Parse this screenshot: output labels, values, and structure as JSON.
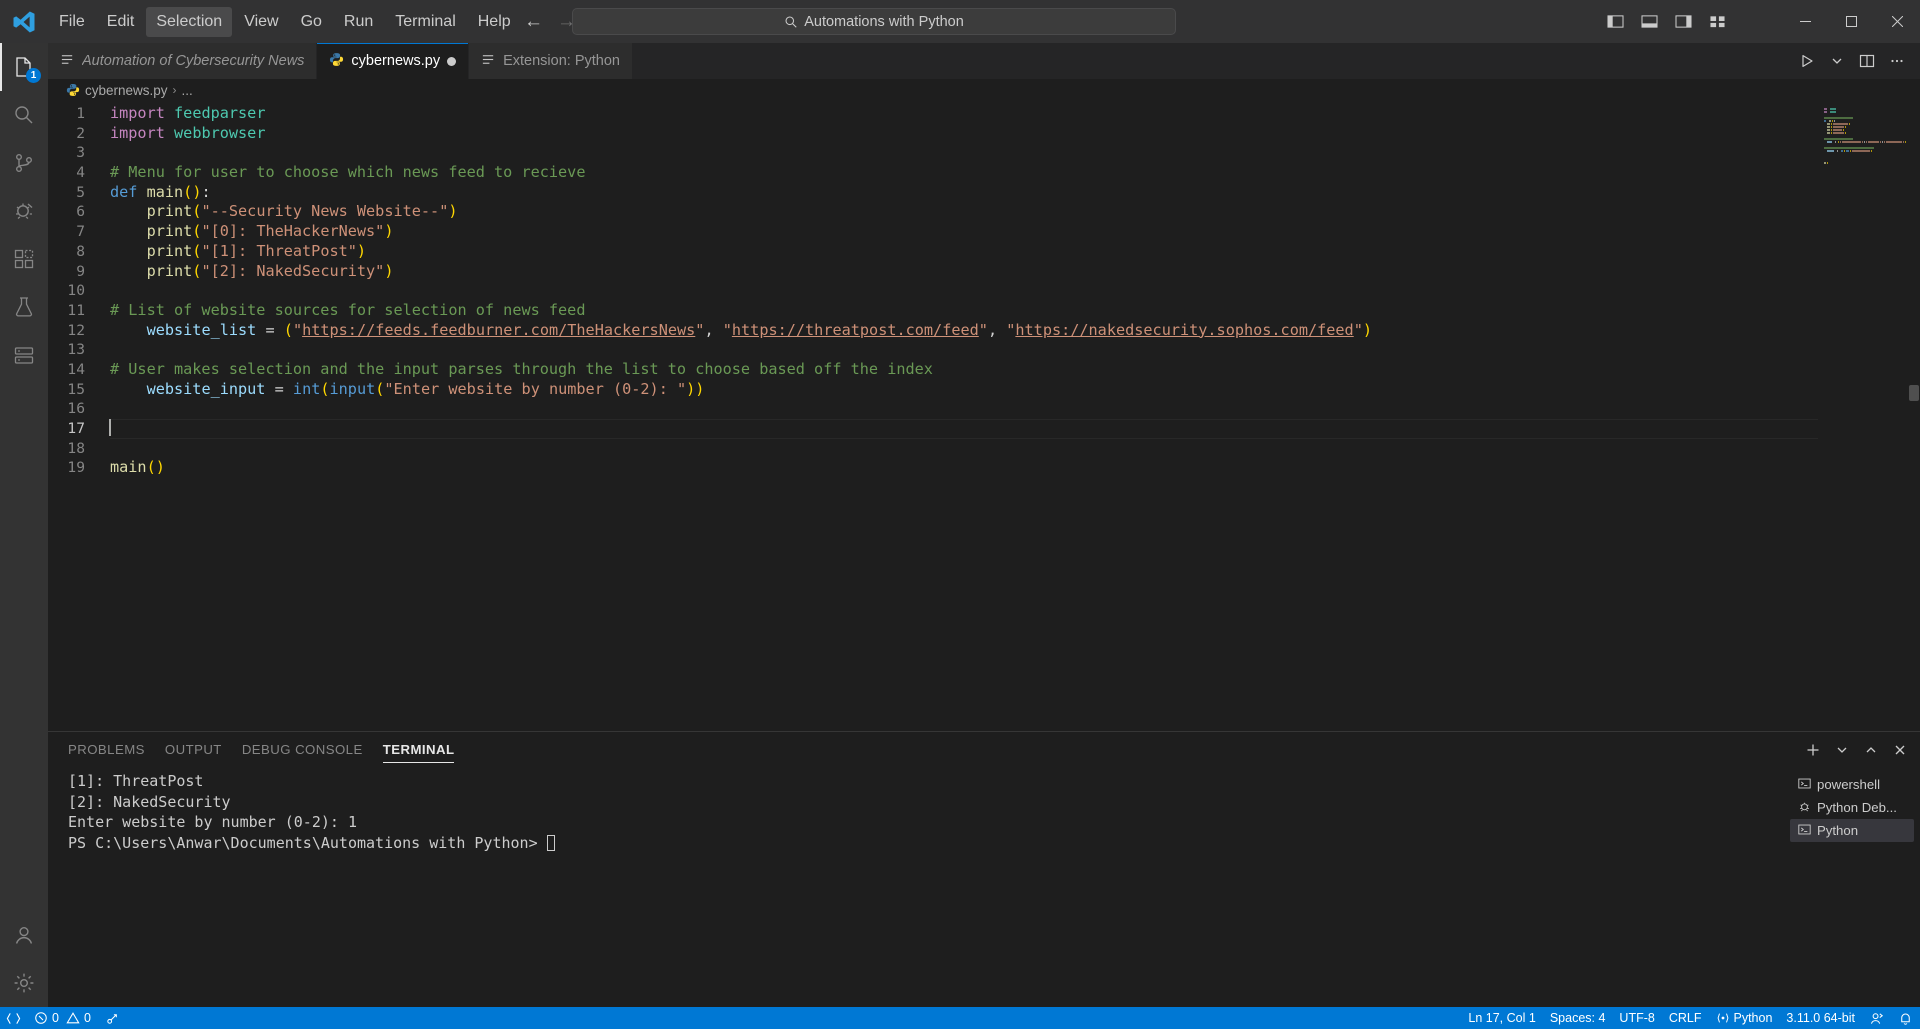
{
  "titlebar": {
    "logo_icon": "vscode-logo-icon",
    "menu": [
      {
        "label": "File",
        "active": false
      },
      {
        "label": "Edit",
        "active": false
      },
      {
        "label": "Selection",
        "active": true
      },
      {
        "label": "View",
        "active": false
      },
      {
        "label": "Go",
        "active": false
      },
      {
        "label": "Run",
        "active": false
      },
      {
        "label": "Terminal",
        "active": false
      },
      {
        "label": "Help",
        "active": false
      }
    ],
    "nav_back_icon": "arrow-left-icon",
    "nav_forward_icon": "arrow-right-icon",
    "search": {
      "value": "Automations with Python",
      "placeholder": "Search",
      "icon": "search-icon"
    },
    "layout_icons": [
      "toggle-primary-sidebar-icon",
      "toggle-panel-icon",
      "toggle-secondary-sidebar-icon",
      "customize-layout-icon"
    ],
    "window_controls": [
      "minimize-icon",
      "maximize-icon",
      "close-icon"
    ]
  },
  "activitybar": {
    "items": [
      {
        "name": "explorer",
        "icon": "files-icon",
        "active": true,
        "badge": "1"
      },
      {
        "name": "search",
        "icon": "search-icon",
        "active": false,
        "badge": ""
      },
      {
        "name": "source-control",
        "icon": "source-control-icon",
        "active": false,
        "badge": ""
      },
      {
        "name": "run-and-debug",
        "icon": "debug-alt-icon",
        "active": false,
        "badge": ""
      },
      {
        "name": "extensions",
        "icon": "extensions-icon",
        "active": false,
        "badge": ""
      },
      {
        "name": "testing",
        "icon": "beaker-icon",
        "active": false,
        "badge": ""
      },
      {
        "name": "remote-explorer",
        "icon": "remote-explorer-icon",
        "active": false,
        "badge": ""
      }
    ],
    "bottom_items": [
      {
        "name": "accounts",
        "icon": "account-icon"
      },
      {
        "name": "manage",
        "icon": "gear-icon"
      }
    ]
  },
  "tabs": [
    {
      "label": "Automation of Cybersecurity News",
      "icon": "markdown-icon",
      "active": false,
      "preview": true,
      "dirty": false
    },
    {
      "label": "cybernews.py",
      "icon": "python-icon",
      "active": true,
      "preview": false,
      "dirty": true
    },
    {
      "label": "Extension: Python",
      "icon": "markdown-icon",
      "active": false,
      "preview": false,
      "dirty": false
    }
  ],
  "tab_actions": [
    {
      "name": "run-python-file",
      "icon": "play-icon"
    },
    {
      "name": "run-options-chevron",
      "icon": "chevron-down-icon"
    },
    {
      "name": "split-editor-right",
      "icon": "split-editor-icon"
    },
    {
      "name": "more-actions",
      "icon": "ellipsis-icon"
    }
  ],
  "breadcrumb": {
    "file_icon": "python-icon",
    "file": "cybernews.py",
    "separator": "›",
    "more": "..."
  },
  "editor": {
    "filename": "cybernews.py",
    "language": "Python",
    "lines": [
      {
        "n": "1",
        "cur": false,
        "tokens": [
          {
            "t": "import",
            "c": "k-import"
          },
          {
            "t": " ",
            "c": "plain"
          },
          {
            "t": "feedparser",
            "c": "mod"
          }
        ]
      },
      {
        "n": "2",
        "cur": false,
        "tokens": [
          {
            "t": "import",
            "c": "k-import"
          },
          {
            "t": " ",
            "c": "plain"
          },
          {
            "t": "webbrowser",
            "c": "mod"
          }
        ]
      },
      {
        "n": "3",
        "cur": false,
        "tokens": []
      },
      {
        "n": "4",
        "cur": false,
        "tokens": [
          {
            "t": "# Menu for user to choose which news feed to recieve",
            "c": "cmt"
          }
        ]
      },
      {
        "n": "5",
        "cur": false,
        "tokens": [
          {
            "t": "def",
            "c": "k-def"
          },
          {
            "t": " ",
            "c": "plain"
          },
          {
            "t": "main",
            "c": "fn"
          },
          {
            "t": "()",
            "c": "paren"
          },
          {
            "t": ":",
            "c": "plain"
          }
        ]
      },
      {
        "n": "6",
        "cur": false,
        "tokens": [
          {
            "t": "    ",
            "c": "plain"
          },
          {
            "t": "print",
            "c": "fn"
          },
          {
            "t": "(",
            "c": "paren"
          },
          {
            "t": "\"--Security News Website--\"",
            "c": "str"
          },
          {
            "t": ")",
            "c": "paren"
          }
        ]
      },
      {
        "n": "7",
        "cur": false,
        "tokens": [
          {
            "t": "    ",
            "c": "plain"
          },
          {
            "t": "print",
            "c": "fn"
          },
          {
            "t": "(",
            "c": "paren"
          },
          {
            "t": "\"[0]: TheHackerNews\"",
            "c": "str"
          },
          {
            "t": ")",
            "c": "paren"
          }
        ]
      },
      {
        "n": "8",
        "cur": false,
        "tokens": [
          {
            "t": "    ",
            "c": "plain"
          },
          {
            "t": "print",
            "c": "fn"
          },
          {
            "t": "(",
            "c": "paren"
          },
          {
            "t": "\"[1]: ThreatPost\"",
            "c": "str"
          },
          {
            "t": ")",
            "c": "paren"
          }
        ]
      },
      {
        "n": "9",
        "cur": false,
        "tokens": [
          {
            "t": "    ",
            "c": "plain"
          },
          {
            "t": "print",
            "c": "fn"
          },
          {
            "t": "(",
            "c": "paren"
          },
          {
            "t": "\"[2]: NakedSecurity\"",
            "c": "str"
          },
          {
            "t": ")",
            "c": "paren"
          }
        ]
      },
      {
        "n": "10",
        "cur": false,
        "tokens": []
      },
      {
        "n": "11",
        "cur": false,
        "tokens": [
          {
            "t": "# List of website sources for selection of news feed",
            "c": "cmt"
          }
        ]
      },
      {
        "n": "12",
        "cur": false,
        "tokens": [
          {
            "t": "    ",
            "c": "plain"
          },
          {
            "t": "website_list",
            "c": "var"
          },
          {
            "t": " ",
            "c": "plain"
          },
          {
            "t": "=",
            "c": "op"
          },
          {
            "t": " ",
            "c": "plain"
          },
          {
            "t": "(",
            "c": "paren"
          },
          {
            "t": "\"",
            "c": "str"
          },
          {
            "t": "https://feeds.feedburner.com/TheHackersNews",
            "c": "link"
          },
          {
            "t": "\"",
            "c": "str"
          },
          {
            "t": ", ",
            "c": "plain"
          },
          {
            "t": "\"",
            "c": "str"
          },
          {
            "t": "https://threatpost.com/feed",
            "c": "link"
          },
          {
            "t": "\"",
            "c": "str"
          },
          {
            "t": ", ",
            "c": "plain"
          },
          {
            "t": "\"",
            "c": "str"
          },
          {
            "t": "https://nakedsecurity.sophos.com/feed",
            "c": "link"
          },
          {
            "t": "\"",
            "c": "str"
          },
          {
            "t": ")",
            "c": "paren"
          }
        ]
      },
      {
        "n": "13",
        "cur": false,
        "tokens": []
      },
      {
        "n": "14",
        "cur": false,
        "tokens": [
          {
            "t": "# User makes selection and the input parses through the list to choose based off the index",
            "c": "cmt"
          }
        ]
      },
      {
        "n": "15",
        "cur": false,
        "tokens": [
          {
            "t": "    ",
            "c": "plain"
          },
          {
            "t": "website_input",
            "c": "var"
          },
          {
            "t": " ",
            "c": "plain"
          },
          {
            "t": "=",
            "c": "op"
          },
          {
            "t": " ",
            "c": "plain"
          },
          {
            "t": "int",
            "c": "k-def"
          },
          {
            "t": "(",
            "c": "paren"
          },
          {
            "t": "input",
            "c": "k-def"
          },
          {
            "t": "(",
            "c": "paren"
          },
          {
            "t": "\"Enter website by number (0-2): \"",
            "c": "str"
          },
          {
            "t": "))",
            "c": "paren"
          }
        ]
      },
      {
        "n": "16",
        "cur": false,
        "tokens": []
      },
      {
        "n": "17",
        "cur": true,
        "tokens": []
      },
      {
        "n": "18",
        "cur": false,
        "tokens": []
      },
      {
        "n": "19",
        "cur": false,
        "tokens": [
          {
            "t": "main",
            "c": "fn"
          },
          {
            "t": "()",
            "c": "paren"
          }
        ]
      }
    ]
  },
  "panel": {
    "tabs": [
      {
        "label": "PROBLEMS",
        "active": false
      },
      {
        "label": "OUTPUT",
        "active": false
      },
      {
        "label": "DEBUG CONSOLE",
        "active": false
      },
      {
        "label": "TERMINAL",
        "active": true
      }
    ],
    "actions": [
      {
        "name": "new-terminal",
        "icon": "plus-icon"
      },
      {
        "name": "split-terminal-chevron",
        "icon": "chevron-down-icon"
      },
      {
        "name": "maximize-panel",
        "icon": "chevron-up-icon"
      },
      {
        "name": "close-panel",
        "icon": "close-icon"
      }
    ],
    "terminal_output": [
      "[1]: ThreatPost",
      "[2]: NakedSecurity",
      "Enter website by number (0-2): 1"
    ],
    "terminal_prompt": "PS C:\\Users\\Anwar\\Documents\\Automations with Python> ",
    "terminal_instances": [
      {
        "label": "powershell",
        "icon": "terminal-icon",
        "active": false
      },
      {
        "label": "Python Deb...",
        "icon": "debug-icon",
        "active": false
      },
      {
        "label": "Python",
        "icon": "terminal-icon",
        "active": true
      }
    ]
  },
  "statusbar": {
    "left": [
      {
        "name": "remote-indicator",
        "icon": "remote-icon",
        "label": ""
      },
      {
        "name": "problems",
        "icon": "error-warning-icon",
        "label": "0  0",
        "errors": "0",
        "warnings": "0"
      },
      {
        "name": "ports",
        "icon": "ports-icon",
        "label": ""
      }
    ],
    "right": [
      {
        "name": "editor-position",
        "label": "Ln 17, Col 1"
      },
      {
        "name": "editor-indentation",
        "label": "Spaces: 4"
      },
      {
        "name": "editor-encoding",
        "label": "UTF-8"
      },
      {
        "name": "editor-eol",
        "label": "CRLF"
      },
      {
        "name": "editor-language",
        "label": "Python",
        "icon": "python-status-icon"
      },
      {
        "name": "python-interpreter",
        "label": "3.11.0 64-bit"
      },
      {
        "name": "accounts-status",
        "icon": "account-icon",
        "label": ""
      },
      {
        "name": "notifications",
        "icon": "bell-icon",
        "label": ""
      }
    ],
    "accent": "#0078d4"
  },
  "colors": {
    "titlebar_bg": "#323233",
    "activitybar_bg": "#333333",
    "editor_bg": "#1e1e1e",
    "tab_inactive_bg": "#2d2d2d",
    "tabbar_bg": "#252526",
    "status_bg": "#0078d4",
    "accent_blue": "#0078d4"
  }
}
